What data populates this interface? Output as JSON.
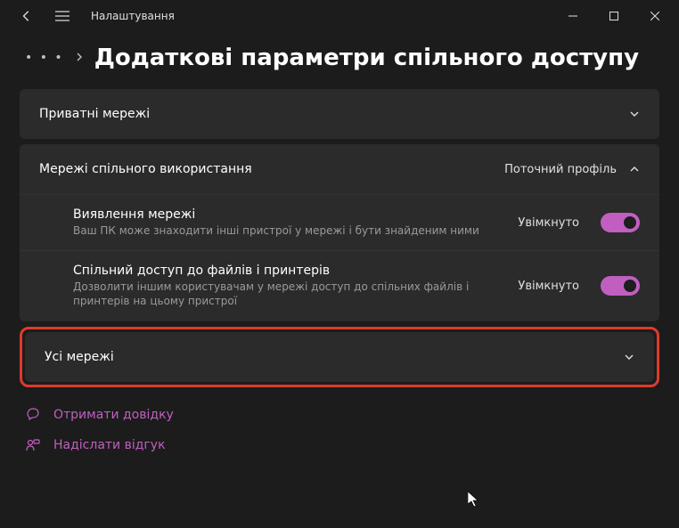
{
  "titlebar": {
    "app_title": "Налаштування"
  },
  "header": {
    "dots": "• • •",
    "page_title": "Додаткові параметри спільного доступу"
  },
  "panels": {
    "private": {
      "label": "Приватні мережі"
    },
    "shared": {
      "label": "Мережі спільного використання",
      "badge": "Поточний профіль",
      "items": [
        {
          "title": "Виявлення мережі",
          "desc": "Ваш ПК може знаходити інші пристрої у мережі і бути знайденим ними",
          "state": "Увімкнуто"
        },
        {
          "title": "Спільний доступ до файлів і принтерів",
          "desc": "Дозволити іншим користувачам у мережі доступ до спільних файлів і принтерів на цьому пристрої",
          "state": "Увімкнуто"
        }
      ]
    },
    "all": {
      "label": "Усі мережі"
    }
  },
  "links": {
    "help": "Отримати довідку",
    "feedback": "Надіслати відгук"
  }
}
